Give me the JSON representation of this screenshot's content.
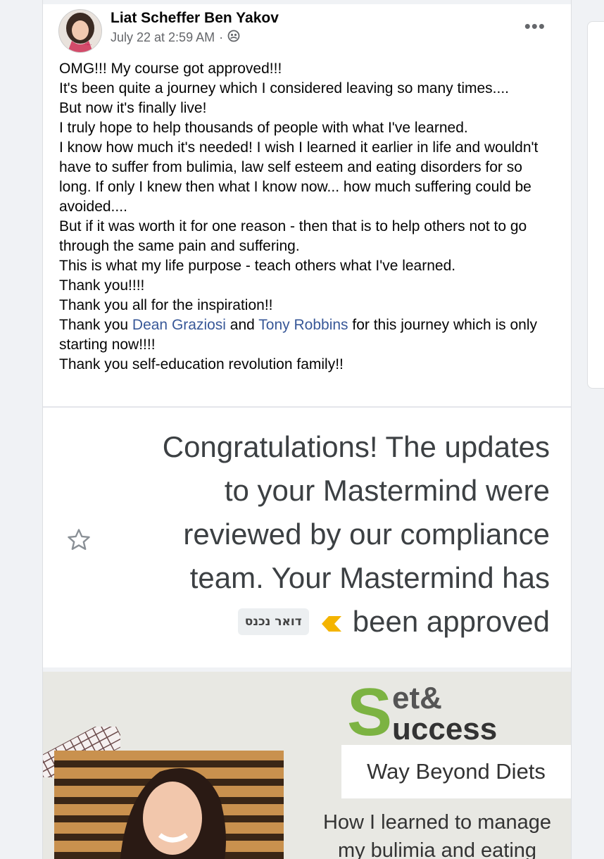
{
  "post": {
    "author": "Liat Scheffer Ben Yakov",
    "timestamp": "July 22 at 2:59 AM",
    "meta_separator": "·",
    "privacy_icon": "friends-icon",
    "more_label": "•••",
    "text_lines": [
      "OMG!!! My course got approved!!!",
      "It's been quite a journey which I considered leaving so many times....",
      "But now it's finally live!",
      "I truly hope to help thousands of people with what I've learned.",
      "I know how much it's needed! I wish I learned it earlier in life and wouldn't have to suffer from bulimia, law self esteem and eating disorders for so long. If only I knew then what I know now... how much suffering could be avoided....",
      "But if it was worth it for one reason - then that is to help others not to go through the same pain and suffering.",
      "This is what my life purpose - teach others what I've learned.",
      "Thank you!!!!",
      "Thank you all for the inspiration!!"
    ],
    "thanks_line": {
      "prefix": "Thank you ",
      "mention1": "Dean Graziosi",
      "middle": " and ",
      "mention2": "Tony Robbins",
      "suffix": " for this journey which is only starting now!!!!"
    },
    "closing_line": "Thank you self-education revolution family!!"
  },
  "email_screenshot": {
    "lines": [
      "Congratulations! The updates",
      "to your Mastermind were",
      "reviewed by our compliance",
      "team. Your Mastermind has",
      "been approved"
    ],
    "inbox_label": "דואר נכנס",
    "star_icon": "star-icon",
    "importance_icon": "importance-marker-icon",
    "importance_color": "#f4b400"
  },
  "promo_image": {
    "logo_top": "et&",
    "logo_bottom": "uccess",
    "logo_letter": "S",
    "tagline": "Way Beyond Diets",
    "headline_lines": [
      "How I learned to manage",
      "my bulimia and eating"
    ],
    "brand_green": "#7cb342"
  },
  "colors": {
    "link": "#385898",
    "text": "#050505",
    "secondary": "#65676b"
  }
}
